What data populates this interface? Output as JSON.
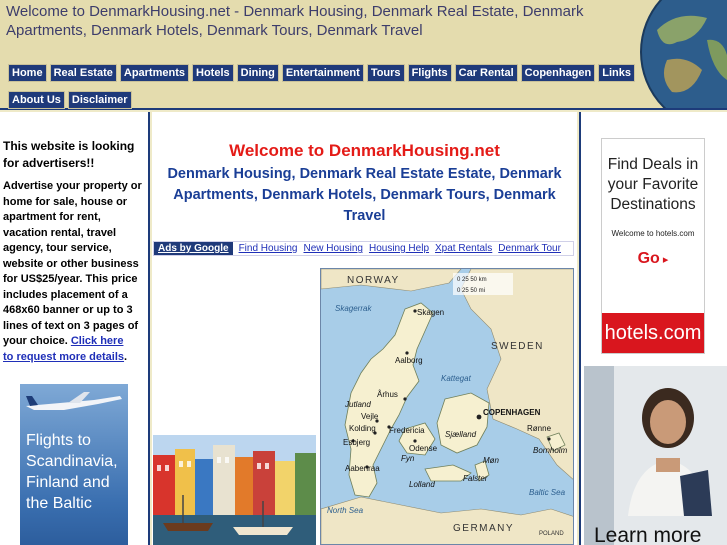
{
  "header": {
    "title": "Welcome to DenmarkHousing.net - Denmark Housing, Denmark Real Estate, Denmark Apartments, Denmark Hotels, Denmark Tours, Denmark Travel"
  },
  "nav": {
    "row1": [
      "Home",
      "Real Estate",
      "Apartments",
      "Hotels",
      "Dining",
      "Entertainment",
      "Tours",
      "Flights",
      "Car Rental",
      "Copenhagen",
      "Links"
    ],
    "row2": [
      "About Us",
      "Disclaimer"
    ]
  },
  "left": {
    "heading": "This website is looking for advertisers!!",
    "body": "Advertise your property or home for sale, house or apartment for rent, vacation rental, travel agency, tour service, website or other business for US$25/year. This price includes placement of a 468x60 banner or up to 3 lines of text on 3 pages of your choice.",
    "link1": "Click here",
    "link2": "to request more details",
    "after_link": ".",
    "banner_text": "Flights to Scandinavia, Finland and the Baltic"
  },
  "center": {
    "welcome": "Welcome to DenmarkHousing.net",
    "subtitle": "Denmark Housing, Denmark Real Estate Estate, Denmark Apartments, Denmark Hotels, Denmark Tours, Denmark Travel",
    "ads_by": "Ads by Google",
    "ad_links": [
      "Find Housing",
      "New Housing",
      "Housing Help",
      "Xpat Rentals",
      "Denmark Tour"
    ]
  },
  "map": {
    "norway": "NORWAY",
    "sweden": "SWEDEN",
    "germany": "GERMANY",
    "poland": "POLAND",
    "skagerrak": "Skagerrak",
    "kattegat": "Kattegat",
    "north_sea": "North Sea",
    "baltic_sea": "Baltic Sea",
    "scale_top": "0   25   50 km",
    "scale_bottom": "0    25    50 mi",
    "cities": [
      "Skagen",
      "Aalborg",
      "Århus",
      "Jutland",
      "Vejle",
      "Kolding",
      "Esbjerg",
      "Aabenraa",
      "Fredericia",
      "Odense",
      "Fyn",
      "Sjælland",
      "COPENHAGEN",
      "Rønne",
      "Bornholm",
      "Møn",
      "Lolland",
      "Falster"
    ]
  },
  "right": {
    "hotels_deals": "Find Deals in your Favorite Destinations",
    "hotels_small": "Welcome to hotels.com",
    "hotels_go": "Go",
    "hotels_brand": "hotels.com",
    "learn_more": "Learn more"
  },
  "colors": {
    "nav_bg": "#1f3a7a",
    "welcome": "#e41b17",
    "subtitle": "#1a3e96",
    "hotels_red": "#d9161e"
  }
}
